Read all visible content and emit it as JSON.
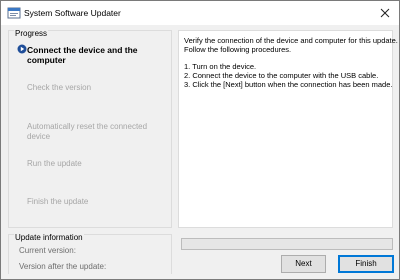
{
  "window": {
    "title": "System Software Updater",
    "icon": "app-window-icon",
    "close_icon": "close-icon"
  },
  "progress": {
    "group_label": "Progress",
    "steps": [
      {
        "label": "Connect the device and the computer",
        "state": "active"
      },
      {
        "label": "Check the version",
        "state": "pending"
      },
      {
        "label": "Automatically reset the connected device",
        "state": "pending"
      },
      {
        "label": "Run the update",
        "state": "pending"
      },
      {
        "label": "Finish the update",
        "state": "pending"
      }
    ],
    "active_indicator_icon": "play-circle-icon"
  },
  "instructions": {
    "lines": [
      "Verify the connection of the device and computer for this update.",
      "Follow the following procedures.",
      "1. Turn on the device.",
      "2. Connect the device to the computer with the USB cable.",
      "3. Click the [Next] button when the connection has been made."
    ]
  },
  "update_info": {
    "group_label": "Update information",
    "current_version_label": "Current version:",
    "current_version_value": "",
    "after_version_label": "Version after the update:",
    "after_version_value": ""
  },
  "progress_bar": {
    "value": 0
  },
  "buttons": {
    "next": "Next",
    "finish": "Finish"
  },
  "colors": {
    "titlebar": "#ffffff",
    "window_bg": "#f0f0f0",
    "inactive_text": "#a6a6a6",
    "focus_border": "#0078d7",
    "indicator": "#1f4e99"
  }
}
